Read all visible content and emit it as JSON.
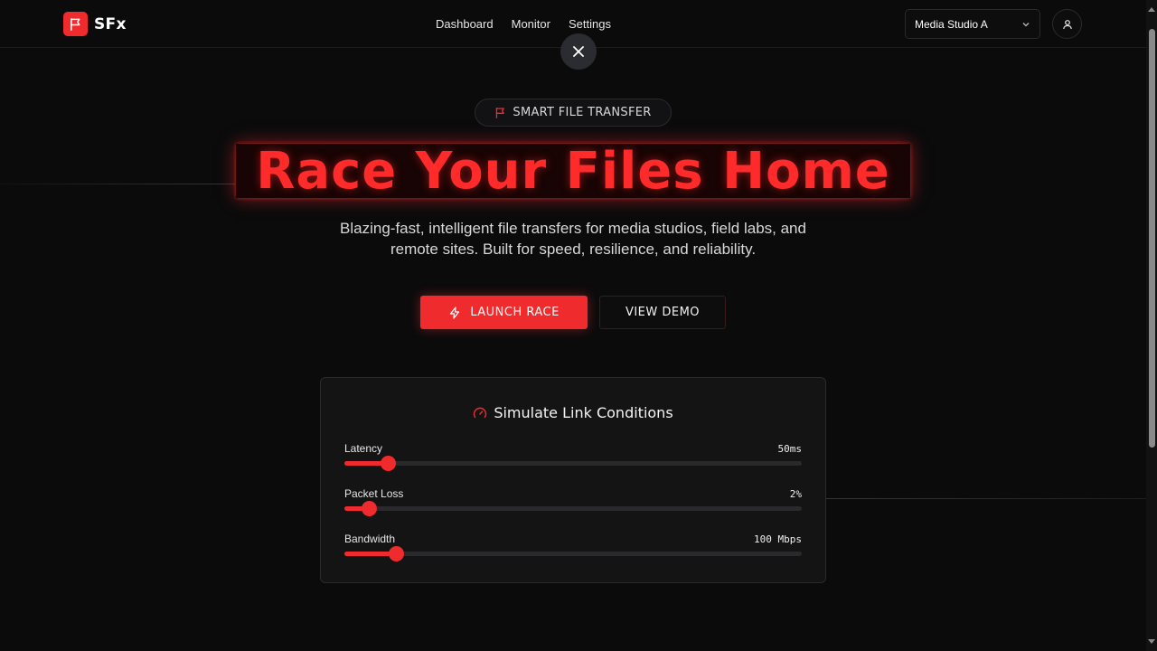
{
  "brand": {
    "name": "SFx",
    "accent": "#ef2b2d",
    "icon": "flag-icon"
  },
  "nav": {
    "items": [
      "Dashboard",
      "Monitor",
      "Settings"
    ]
  },
  "workspace_select": {
    "value": "Media Studio A"
  },
  "close_icon": "close-icon",
  "user_icon": "user-icon",
  "hero": {
    "pill": "SMART FILE TRANSFER",
    "title": "Race Your Files Home",
    "subtitle_line1": "Blazing-fast, intelligent file transfers for media studios, field labs, and",
    "subtitle_line2": "remote sites. Built for speed, resilience, and reliability.",
    "primary_button": "LAUNCH RACE",
    "secondary_button": "VIEW DEMO"
  },
  "simulator": {
    "title": "Simulate Link Conditions",
    "sliders": [
      {
        "label": "Latency",
        "value": "50ms",
        "fraction": 0.094
      },
      {
        "label": "Packet Loss",
        "value": "2%",
        "fraction": 0.054
      },
      {
        "label": "Bandwidth",
        "value": "100 Mbps",
        "fraction": 0.113
      }
    ]
  }
}
